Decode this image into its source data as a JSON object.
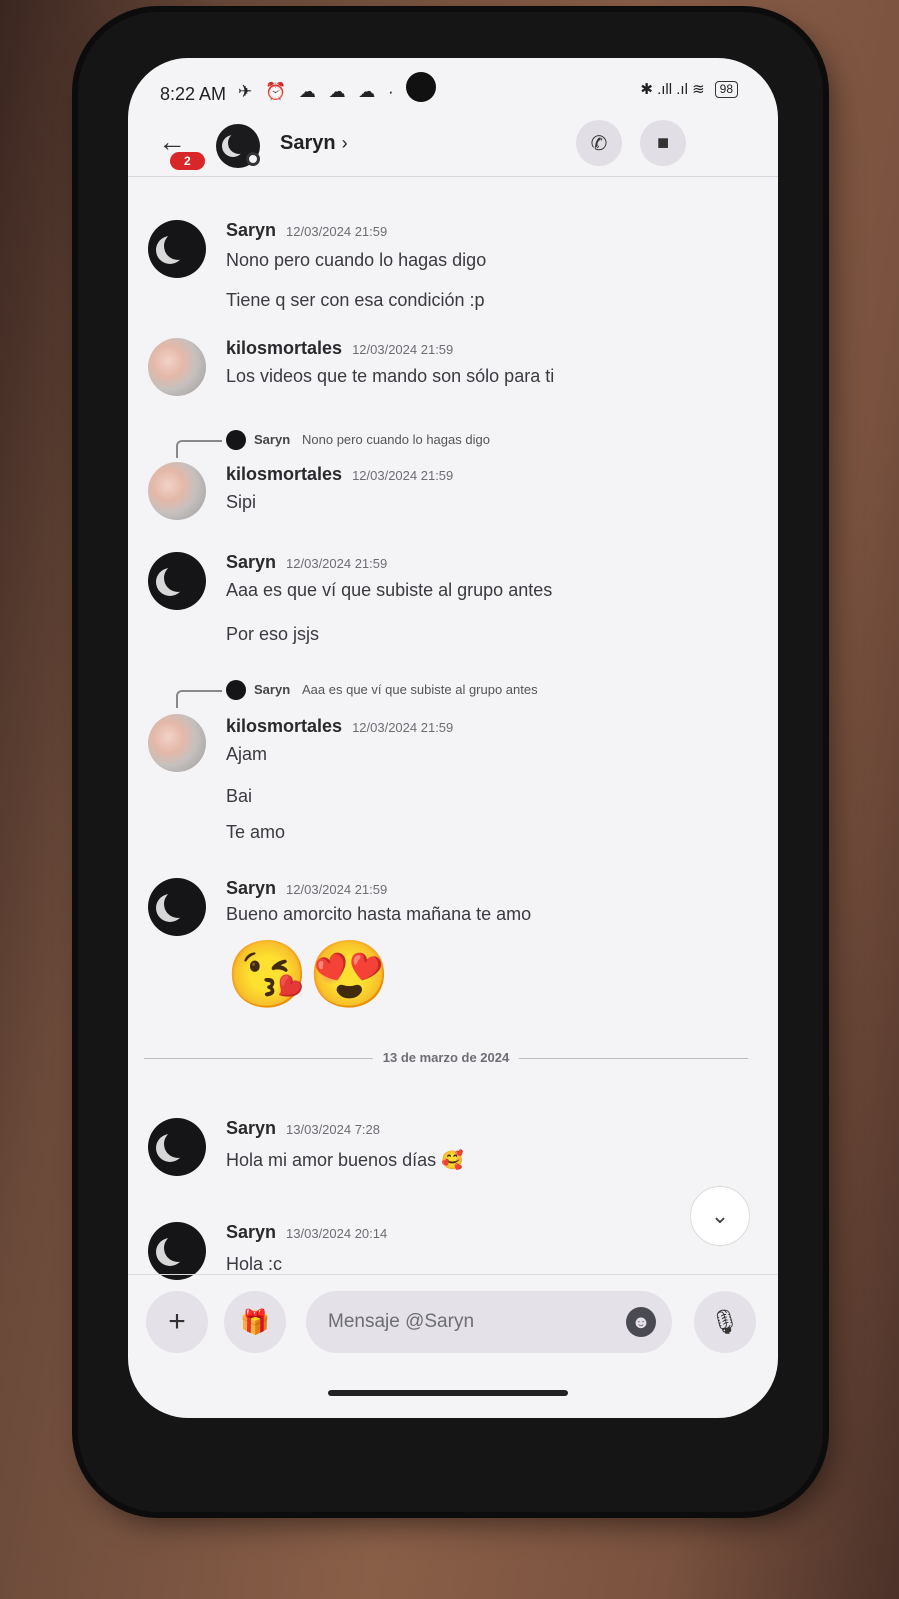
{
  "status_bar": {
    "time": "8:22 AM",
    "left_icons": "✈ ⏰ ☁ ☁ ☁ ·",
    "right_icons": "✱ .ıll .ıl ≋",
    "battery": "98"
  },
  "header": {
    "back_badge": "2",
    "title": "Saryn",
    "chevron": "›",
    "call_icon": "phone-icon",
    "video_icon": "video-icon"
  },
  "messages": [
    {
      "author": "Saryn",
      "timestamp": "12/03/2024 21:59",
      "lines": [
        "Nono pero cuando lo hagas digo",
        "Tiene q ser con esa condición :p"
      ]
    },
    {
      "author": "kilosmortales",
      "timestamp": "12/03/2024 21:59",
      "lines": [
        "Los videos que te mando son sólo para ti"
      ]
    },
    {
      "reply_author": "Saryn",
      "reply_text": "Nono pero cuando lo hagas digo",
      "author": "kilosmortales",
      "timestamp": "12/03/2024 21:59",
      "lines": [
        "Sipi"
      ]
    },
    {
      "author": "Saryn",
      "timestamp": "12/03/2024 21:59",
      "lines": [
        "Aaa es que ví que subiste al grupo antes",
        "Por eso jsjs"
      ]
    },
    {
      "reply_author": "Saryn",
      "reply_text": "Aaa es que ví que subiste al grupo antes",
      "author": "kilosmortales",
      "timestamp": "12/03/2024 21:59",
      "lines": [
        "Ajam",
        "Bai",
        "Te amo"
      ]
    },
    {
      "author": "Saryn",
      "timestamp": "12/03/2024 21:59",
      "lines": [
        "Bueno amorcito hasta mañana te amo"
      ],
      "emojis": "😘😍"
    },
    {
      "author": "Saryn",
      "timestamp": "13/03/2024 7:28",
      "lines": [
        "Hola mi amor buenos días 🥰"
      ]
    },
    {
      "author": "Saryn",
      "timestamp": "13/03/2024 20:14",
      "lines": [
        "Hola :c"
      ]
    }
  ],
  "date_divider": "13 de marzo de 2024",
  "composer": {
    "placeholder": "Mensaje @Saryn",
    "add_label": "+",
    "gift_label": "🎁",
    "emoji_label": "☻",
    "mic_label": "🎙"
  }
}
